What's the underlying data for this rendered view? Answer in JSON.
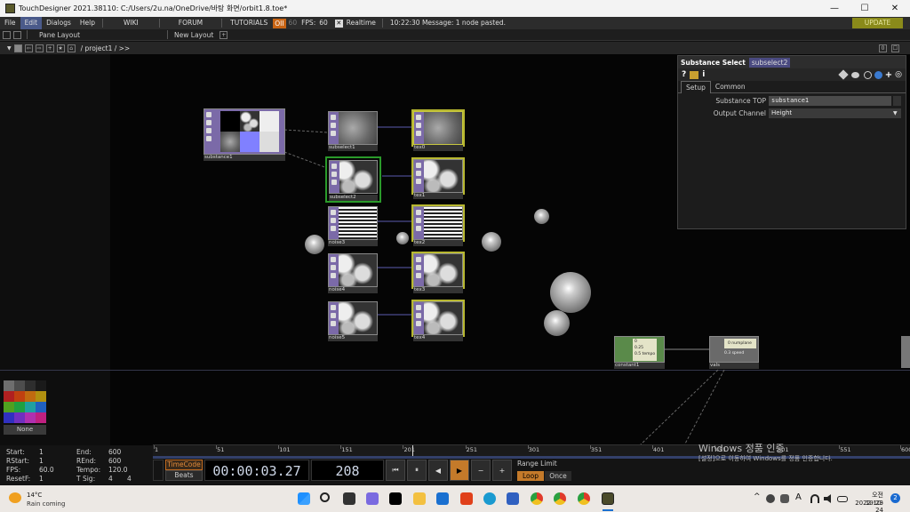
{
  "window": {
    "title": "TouchDesigner 2021.38110: C:/Users/2u.na/OneDrive/바탕 화면/orbit1.8.toe*",
    "minimize": "—",
    "maximize": "☐",
    "close": "✕"
  },
  "menubar": {
    "items": [
      "File",
      "Edit",
      "Dialogs",
      "Help"
    ],
    "wiki": "WIKI",
    "forum": "FORUM",
    "tutorials": "TUTORIALS",
    "oii": "OII",
    "oii_value": "60",
    "fps_label": "FPS:",
    "fps_value": "60",
    "realtime_check": "✕",
    "realtime": "Realtime",
    "message": "10:22:30 Message: 1 node pasted.",
    "update": "UPDATE"
  },
  "panebar": {
    "pane_layout": "Pane Layout",
    "new_layout": "New Layout",
    "plus": "+"
  },
  "pathbar": {
    "path": "/ project1 / >>",
    "right_a": "0",
    "right_b": "☐"
  },
  "nodes": {
    "substance1": "substance1",
    "subselect1": "subselect1",
    "subselect2": "subselect2",
    "noise3": "noise3",
    "noise4": "noise4",
    "noise5": "noise5",
    "tex0": "tex0",
    "tex1": "tex1",
    "tex2": "tex2",
    "tex3": "tex3",
    "tex4": "tex4",
    "constant1": "constant1",
    "constant1_lines": [
      "0",
      "0.25",
      "0.5 tempo"
    ],
    "vals": "vals",
    "vals_lines": [
      "0 numplane",
      "0.3 speed"
    ]
  },
  "params": {
    "op_type": "Substance Select",
    "op_name": "subselect2",
    "tabs": [
      "Setup",
      "Common"
    ],
    "rows": [
      {
        "label": "Substance TOP",
        "value": "substance1"
      },
      {
        "label": "Output Channel",
        "value": "Height"
      }
    ],
    "icons": [
      "?",
      "i",
      "+",
      "◎"
    ]
  },
  "palette": {
    "label": "None",
    "colors": [
      "#6e6e6e",
      "#4d4d4d",
      "#2e2e2e",
      "#1a1a1a",
      "#b02020",
      "#c04010",
      "#c06a10",
      "#b09010",
      "#50a020",
      "#20a040",
      "#20a0a0",
      "#2060c0",
      "#3030c0",
      "#7030c0",
      "#b030b0",
      "#c02080"
    ]
  },
  "time_info": {
    "start_label": "Start:",
    "start": "1",
    "rstart_label": "RStart:",
    "rstart": "1",
    "fps_label": "FPS:",
    "fps": "60.0",
    "resetf_label": "ResetF:",
    "resetf": "1",
    "end_label": "End:",
    "end": "600",
    "rend_label": "REnd:",
    "rend": "600",
    "tempo_label": "Tempo:",
    "tempo": "120.0",
    "tsig_label": "T Sig:",
    "tsig_a": "4",
    "tsig_b": "4"
  },
  "timeline": {
    "ticks": [
      "1",
      "51",
      "101",
      "151",
      "201",
      "251",
      "301",
      "351",
      "401",
      "451",
      "501",
      "551",
      "600"
    ],
    "playhead": 208
  },
  "transport": {
    "timecode": "TimeCode",
    "beats": "Beats",
    "time": "00:00:03.27",
    "frame": "208",
    "buttons": [
      "⏮",
      "⏸",
      "◀",
      "▶",
      "−",
      "+"
    ],
    "range_limit": "Range Limit",
    "loop": "Loop",
    "once": "Once"
  },
  "watermark": {
    "title": "Windows 정품 인증",
    "subtitle": "[설정]으로 이동하여 Windows를 정품 인증합니다."
  },
  "taskbar": {
    "weather_temp": "14°C",
    "weather_desc": "Rain coming",
    "lang": "A",
    "time": "오전 10:23",
    "date": "2022-10-24",
    "notification": "2",
    "tray_chevron": "^"
  }
}
